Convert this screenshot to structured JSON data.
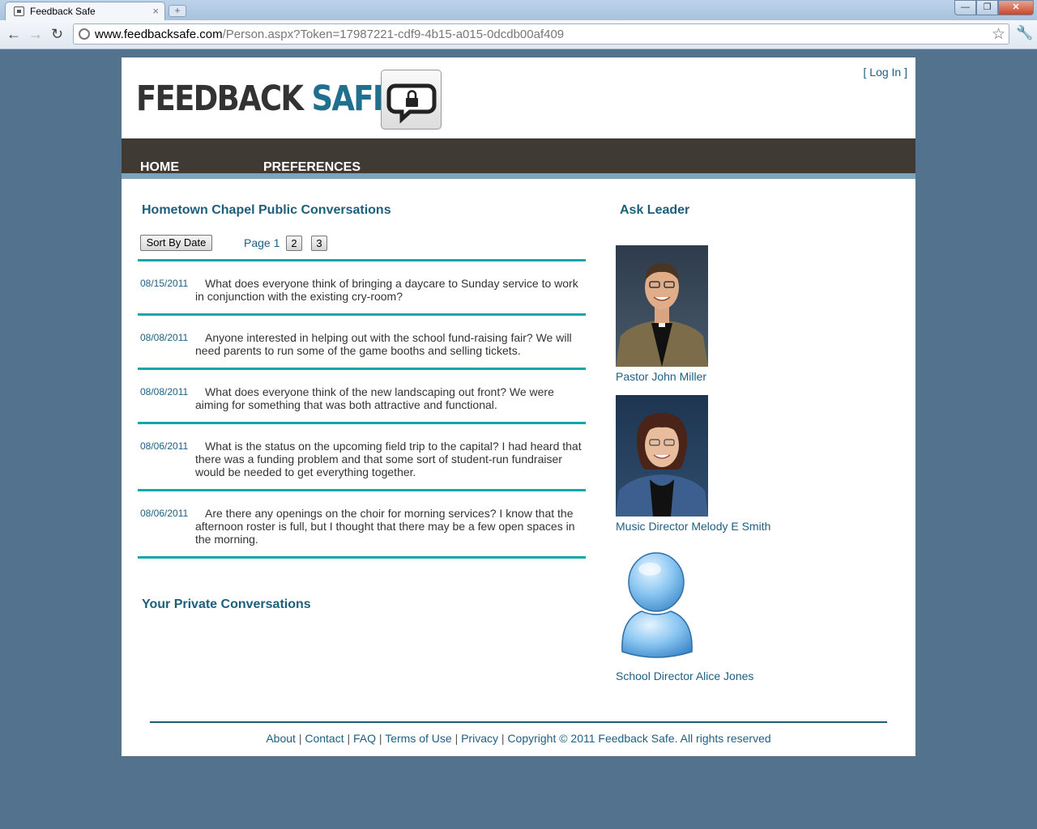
{
  "browser": {
    "tab_title": "Feedback Safe",
    "tab_close": "×",
    "new_tab": "+",
    "url_host": "www.feedbacksafe.com",
    "url_path": "/Person.aspx?Token=17987221-cdf9-4b15-a015-0dcdb00af409",
    "window_buttons": {
      "minimize": "—",
      "maximize": "❐",
      "close": "✕"
    },
    "back": "←",
    "forward": "→",
    "reload": "↻",
    "star": "☆",
    "wrench": "🔧"
  },
  "header": {
    "logo_word1": "FEEDBACK",
    "logo_word2": "SAFE",
    "login": "[ Log In ]"
  },
  "nav": {
    "home": "HOME",
    "preferences": "PREFERENCES"
  },
  "public": {
    "title": "Hometown Chapel Public Conversations",
    "sort_button": "Sort By Date",
    "page_label": "Page 1",
    "pages": [
      "2",
      "3"
    ],
    "conversations": [
      {
        "date": "08/15/2011",
        "text": "What does everyone think of bringing a daycare to Sunday service to work in conjunction with the existing cry-room?"
      },
      {
        "date": "08/08/2011",
        "text": "Anyone interested in helping out with the school fund-raising fair? We will need parents to run some of the game booths and selling tickets."
      },
      {
        "date": "08/08/2011",
        "text": "What does everyone think of the new landscaping out front? We were aiming for something that was both attractive and functional."
      },
      {
        "date": "08/06/2011",
        "text": "What is the status on the upcoming field trip to the capital? I had heard that there was a funding problem and that some sort of student-run fundraiser would be needed to get everything together."
      },
      {
        "date": "08/06/2011",
        "text": "Are there any openings on the choir for morning services? I know that the afternoon roster is full, but I thought that there may be a few open spaces in the morning."
      }
    ]
  },
  "private": {
    "title": "Your Private Conversations"
  },
  "ask_leader": {
    "title": "Ask Leader",
    "leaders": [
      {
        "name": "Pastor John Miller"
      },
      {
        "name": "Music Director Melody E Smith"
      },
      {
        "name": "School Director Alice Jones"
      }
    ]
  },
  "footer": {
    "links": [
      "About",
      "Contact",
      "FAQ",
      "Terms of Use",
      "Privacy"
    ],
    "copyright": "Copyright © 2011 Feedback Safe. All rights reserved"
  }
}
